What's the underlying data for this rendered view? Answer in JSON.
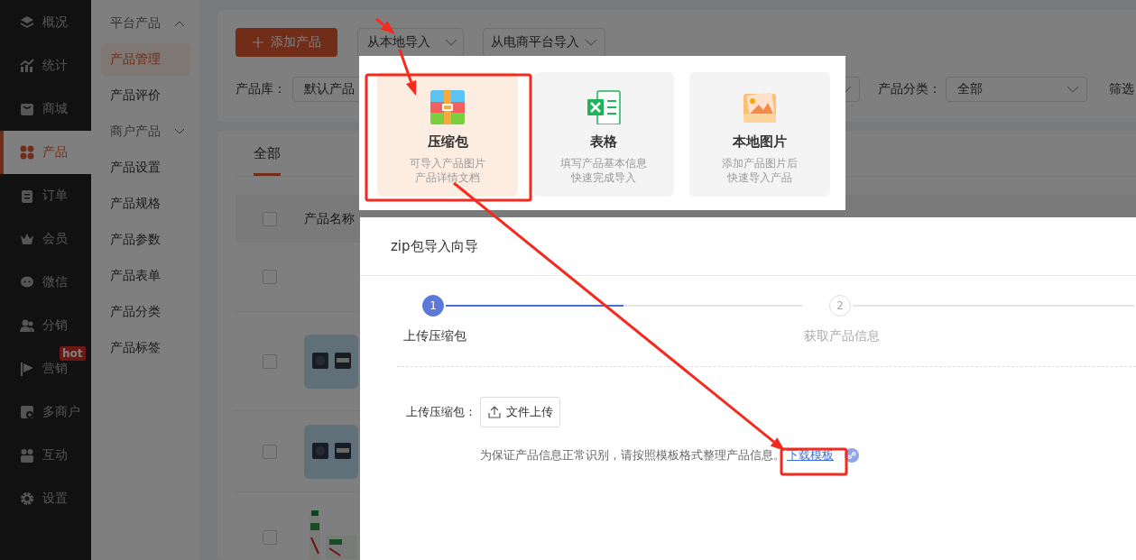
{
  "sidebar": {
    "items": [
      {
        "label": "概况",
        "selected": false
      },
      {
        "label": "统计",
        "selected": false
      },
      {
        "label": "商城",
        "selected": false
      },
      {
        "label": "产品",
        "selected": true
      },
      {
        "label": "订单",
        "selected": false
      },
      {
        "label": "会员",
        "selected": false
      },
      {
        "label": "微信",
        "selected": false
      },
      {
        "label": "分销",
        "selected": false
      },
      {
        "label": "营销",
        "selected": false,
        "badge": "hot"
      },
      {
        "label": "多商户",
        "selected": false
      },
      {
        "label": "互动",
        "selected": false
      },
      {
        "label": "设置",
        "selected": false
      }
    ]
  },
  "submenu": {
    "items": [
      {
        "kind": "group",
        "label": "平台产品",
        "expanded": true
      },
      {
        "kind": "link",
        "label": "产品管理",
        "selected": true
      },
      {
        "kind": "link",
        "label": "产品评价",
        "selected": false
      },
      {
        "kind": "group",
        "label": "商户产品",
        "expanded": false
      },
      {
        "kind": "link",
        "label": "产品设置",
        "selected": false
      },
      {
        "kind": "link",
        "label": "产品规格",
        "selected": false
      },
      {
        "kind": "link",
        "label": "产品参数",
        "selected": false
      },
      {
        "kind": "link",
        "label": "产品表单",
        "selected": false
      },
      {
        "kind": "link",
        "label": "产品分类",
        "selected": false
      },
      {
        "kind": "link",
        "label": "产品标签",
        "selected": false
      }
    ]
  },
  "toolbar": {
    "add_button": "添加产品",
    "import_buttons": [
      "从本地导入",
      "从电商平台导入"
    ]
  },
  "filters": {
    "library_label": "产品库：",
    "library_value": "默认产品",
    "category_label": "产品分类：",
    "category_value": "全部",
    "filter_label": "筛选"
  },
  "tabs": [
    {
      "label": "全部",
      "selected": true
    }
  ],
  "table": {
    "header_checked": false,
    "columns": [
      "产品名称"
    ],
    "rows": [
      {
        "checked": false
      },
      {
        "checked": false
      },
      {
        "checked": false
      },
      {
        "checked": false
      }
    ]
  },
  "import_options": [
    {
      "kind": "zip",
      "title": "压缩包",
      "description": [
        "可导入产品图片",
        "产品详情文档"
      ],
      "selected": true
    },
    {
      "kind": "sheet",
      "title": "表格",
      "description": [
        "填写产品基本信息",
        "快速完成导入"
      ],
      "selected": false
    },
    {
      "kind": "images",
      "title": "本地图片",
      "description": [
        "添加产品图片后",
        "快速导入产品"
      ],
      "selected": false
    }
  ],
  "dialog": {
    "title": "zip包导入向导",
    "steps": [
      {
        "number": "1",
        "label": "上传压缩包",
        "selected": true
      },
      {
        "number": "2",
        "label": "获取产品信息",
        "selected": false
      }
    ],
    "upload_label": "上传压缩包：",
    "upload_button": "文件上传",
    "note": "为保证产品信息正常识别，请按照模板格式整理产品信息。",
    "link": "下载模板"
  },
  "annotations": [
    {
      "kind": "arrow"
    },
    {
      "kind": "arrow"
    },
    {
      "kind": "arrow"
    },
    {
      "kind": "box"
    },
    {
      "kind": "box"
    }
  ]
}
